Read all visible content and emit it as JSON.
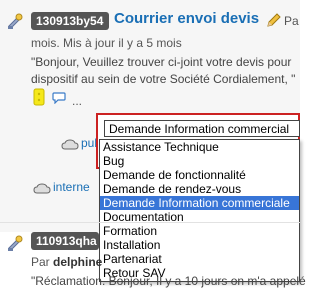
{
  "ticket1": {
    "id_badge": "130913by54",
    "title": "Courrier envoi devis",
    "title_suffix": "Pa",
    "meta": "mois. Mis à jour il y a 5 mois",
    "excerpt_line1": "\"Bonjour,  Veuillez trouver ci-joint votre devis pour",
    "excerpt_line2": "dispositif au sein de votre Société Cordialement, \"",
    "more": "...",
    "tag_public": "public",
    "tag_interne": "interne"
  },
  "select": {
    "current_value": "Demande Information commercial",
    "options": [
      "Assistance Technique",
      "Bug",
      "Demande de fonctionnalité",
      "Demande de rendez-vous",
      "Demande Information commerciale",
      "Documentation",
      "Formation",
      "Installation",
      "Partenariat",
      "Retour SAV"
    ],
    "selected_index": 4
  },
  "ticket2": {
    "id_badge": "110913qha",
    "meta_prefix": "Par ",
    "author": "delphine",
    "excerpt": "\"Réclamation. Bonjour, Il y a 10 jours on m'a appelé"
  },
  "colors": {
    "link": "#1a6fb5",
    "badge_bg": "#555555",
    "highlight_box": "#cc2222",
    "selected_option": "#3875d7"
  }
}
